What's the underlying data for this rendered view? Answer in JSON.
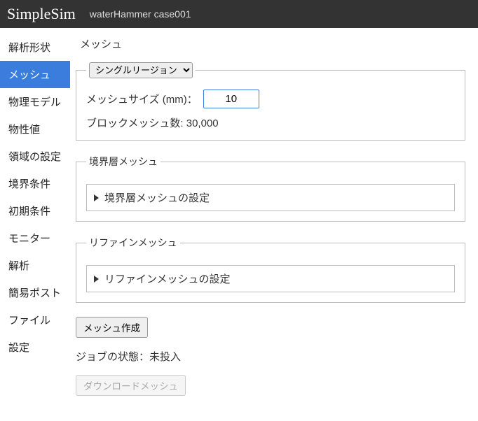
{
  "header": {
    "title": "SimpleSim",
    "subtitle": "waterHammer case001"
  },
  "sidebar": {
    "items": [
      {
        "label": "解析形状"
      },
      {
        "label": "メッシュ"
      },
      {
        "label": "物理モデル"
      },
      {
        "label": "物性値"
      },
      {
        "label": "領域の設定"
      },
      {
        "label": "境界条件"
      },
      {
        "label": "初期条件"
      },
      {
        "label": "モニター"
      },
      {
        "label": "解析"
      },
      {
        "label": "簡易ポスト"
      },
      {
        "label": "ファイル"
      },
      {
        "label": "設定"
      }
    ],
    "active_index": 1
  },
  "page": {
    "title": "メッシュ",
    "region_select": {
      "value": "シングルリージョン"
    },
    "mesh_size": {
      "label": "メッシュサイズ (mm)：",
      "value": "10"
    },
    "block_count": {
      "label": "ブロックメッシュ数:",
      "value": "30,000"
    },
    "boundary_section": {
      "legend": "境界層メッシュ",
      "summary": "境界層メッシュの設定"
    },
    "refine_section": {
      "legend": "リファインメッシュ",
      "summary": "リファインメッシュの設定"
    },
    "make_mesh_btn": "メッシュ作成",
    "job_status": {
      "label": "ジョブの状態：",
      "value": "未投入"
    },
    "download_btn": "ダウンロードメッシュ"
  }
}
